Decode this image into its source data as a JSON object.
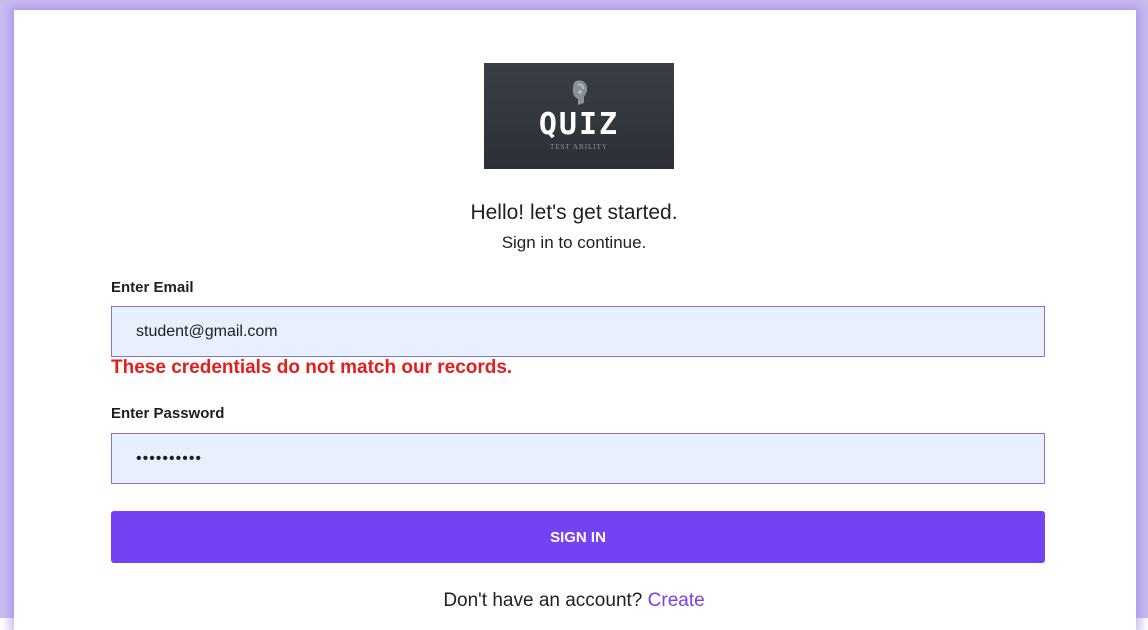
{
  "logo": {
    "title": "QUIZ",
    "tagline": "TEST ABILITY",
    "icon": "head-silhouette-icon"
  },
  "greeting": {
    "headline": "Hello! let's get started.",
    "subline": "Sign in to continue."
  },
  "email": {
    "label": "Enter Email",
    "value": "student@gmail.com",
    "error": "These credentials do not match our records."
  },
  "password": {
    "label": "Enter Password",
    "value": "••••••••••"
  },
  "actions": {
    "signin_label": "SIGN IN"
  },
  "footer": {
    "prompt": "Don't have an account?",
    "create_label": "Create"
  },
  "colors": {
    "accent": "#7442f2",
    "error": "#e31c1c",
    "input_bg": "#e8f0fe"
  }
}
